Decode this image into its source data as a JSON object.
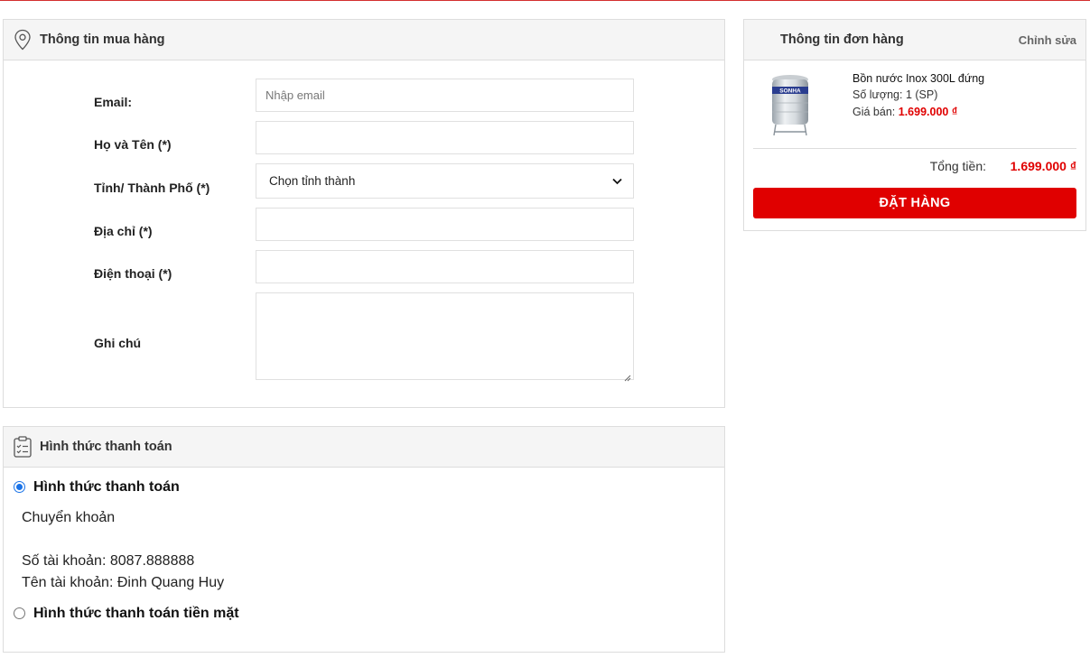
{
  "buyer": {
    "title": "Thông tin mua hàng",
    "email_label": "Email:",
    "email_placeholder": "Nhập email",
    "name_label": "Họ và Tên (*)",
    "city_label": "Tỉnh/ Thành Phố (*)",
    "city_selected": "Chọn tỉnh thành",
    "address_label": "Địa chỉ (*)",
    "phone_label": "Điện thoại (*)",
    "note_label": "Ghi chú"
  },
  "payment": {
    "title": "Hình thức thanh toán",
    "option1_label": "Hình thức thanh toán",
    "option1_selected": true,
    "transfer": "Chuyển khoản",
    "account_number": "Số tài khoản: 8087.888888",
    "account_name": "Tên tài khoản: Đinh Quang Huy",
    "option2_label": "Hình thức thanh toán tiền mặt"
  },
  "order": {
    "title": "Thông tin đơn hàng",
    "edit_label": "Chỉnh sửa",
    "product_name": "Bồn nước Inox 300L đứng",
    "quantity": "Số lượng: 1 (SP)",
    "price_label": "Giá bán:",
    "price_value": "1.699.000 ₫",
    "product_brand": "SONHA",
    "total_label": "Tổng tiền:",
    "total_value": "1.699.000 ₫",
    "order_button": "ĐẶT HÀNG"
  },
  "colors": {
    "accent": "#e00000",
    "radio": "#1a73e8",
    "top_line": "#d32f2f"
  },
  "icons": {
    "buyer": "location-pin-icon",
    "payment": "clipboard-list-icon",
    "select": "chevron-down-icon"
  }
}
